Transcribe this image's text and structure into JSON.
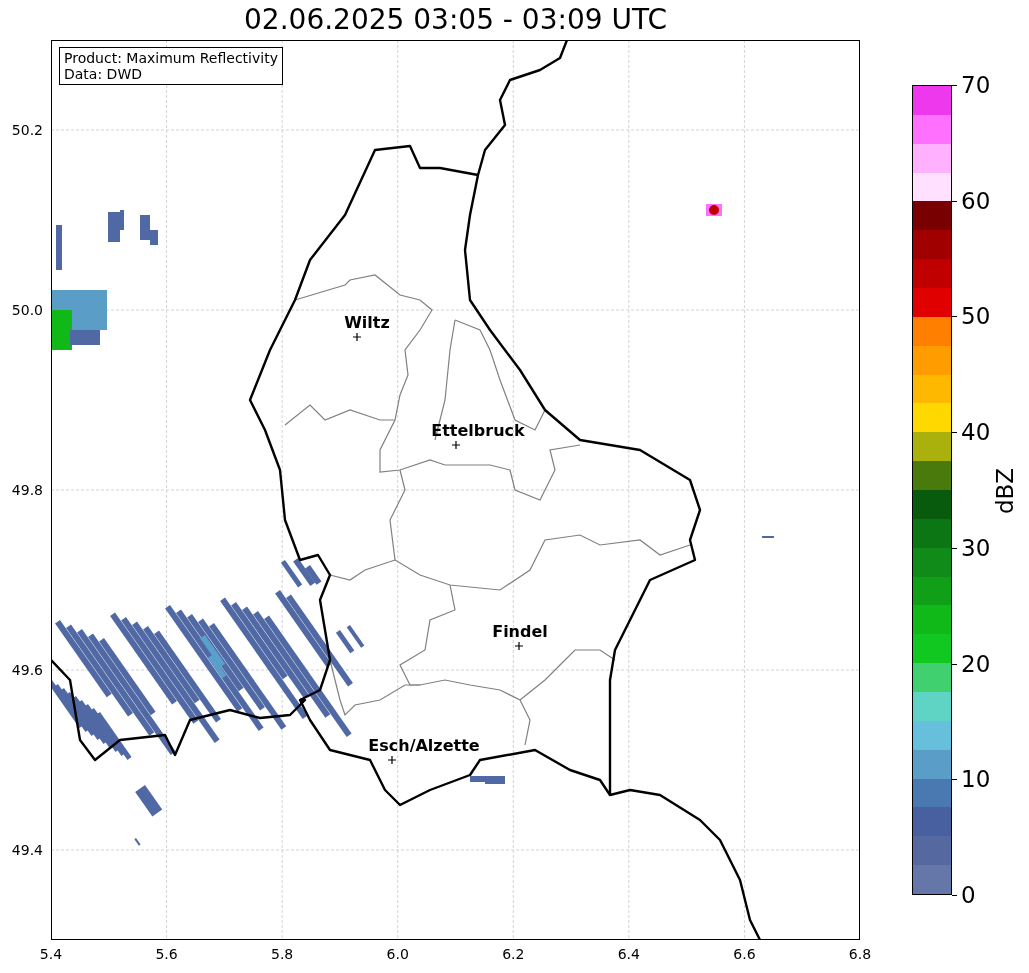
{
  "title": "02.06.2025 03:05 - 03:09 UTC",
  "info_box": [
    "Product: Maximum Reflectivity",
    "Data: DWD"
  ],
  "x_ticks": [
    "5.4",
    "5.6",
    "5.8",
    "6.0",
    "6.2",
    "6.4",
    "6.6",
    "6.8"
  ],
  "y_ticks": [
    "50.2",
    "50.0",
    "49.8",
    "49.6",
    "49.4"
  ],
  "cities": [
    {
      "name": "Wiltz"
    },
    {
      "name": "Ettelbruck"
    },
    {
      "name": "Findel"
    },
    {
      "name": "Esch/Alzette"
    }
  ],
  "colorbar": {
    "label": "dBZ",
    "ticks": [
      "70",
      "60",
      "50",
      "40",
      "30",
      "20",
      "10",
      "0"
    ],
    "segments": [
      {
        "color": "#6577a8"
      },
      {
        "color": "#5569a0"
      },
      {
        "color": "#4860a0"
      },
      {
        "color": "#4a78b0"
      },
      {
        "color": "#5a9ec8"
      },
      {
        "color": "#66c0dc"
      },
      {
        "color": "#60d4c4"
      },
      {
        "color": "#40d070"
      },
      {
        "color": "#10c820"
      },
      {
        "color": "#10b818"
      },
      {
        "color": "#10a018"
      },
      {
        "color": "#108a18"
      },
      {
        "color": "#0c7614"
      },
      {
        "color": "#085a0c"
      },
      {
        "color": "#4a7a0c"
      },
      {
        "color": "#aab00c"
      },
      {
        "color": "#ffd800"
      },
      {
        "color": "#ffb800"
      },
      {
        "color": "#ff9c00"
      },
      {
        "color": "#ff8000"
      },
      {
        "color": "#e00000"
      },
      {
        "color": "#c00000"
      },
      {
        "color": "#a00000"
      },
      {
        "color": "#780000"
      },
      {
        "color": "#ffe0ff"
      },
      {
        "color": "#ffb0ff"
      },
      {
        "color": "#ff70ff"
      },
      {
        "color": "#ee38ee"
      }
    ]
  }
}
